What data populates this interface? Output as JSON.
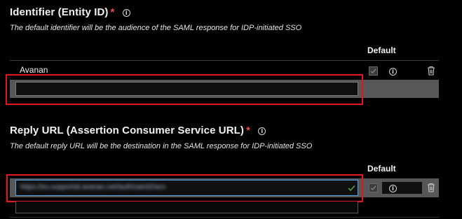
{
  "entity_id": {
    "title": "Identifier (Entity ID)",
    "required_mark": "*",
    "description": "The default identifier will be the audience of the SAML response for IDP-initiated SSO",
    "default_header": "Default",
    "rows": [
      {
        "value": "Avanan",
        "default_checked": true
      }
    ],
    "new_value": ""
  },
  "reply_url": {
    "title": "Reply URL (Assertion Consumer Service URL)",
    "required_mark": "*",
    "description": "The default reply URL will be the destination in the SAML response for IDP-initiated SSO",
    "default_header": "Default",
    "rows": [
      {
        "value": "https://eu.supportal.avanan.net/auth/saml2/acs",
        "default_checked": true
      }
    ],
    "new_value": ""
  },
  "colors": {
    "accent": "#0078d4",
    "highlight": "#e3171c",
    "success": "#57a64a",
    "required": "#f14c4c"
  }
}
